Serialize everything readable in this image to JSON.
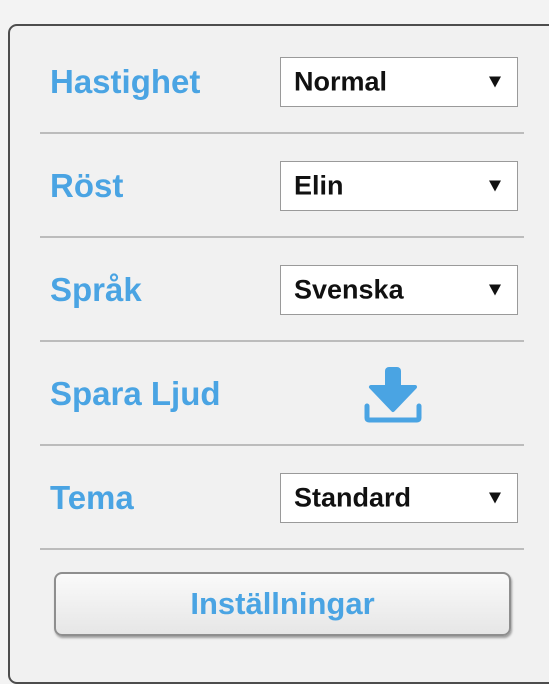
{
  "settings": {
    "rows": [
      {
        "label": "Hastighet",
        "value": "Normal"
      },
      {
        "label": "Röst",
        "value": "Elin"
      },
      {
        "label": "Språk",
        "value": "Svenska"
      },
      {
        "label": "Spara Ljud",
        "icon": "download-icon"
      },
      {
        "label": "Tema",
        "value": "Standard"
      }
    ],
    "button_label": "Inställningar"
  },
  "colors": {
    "accent": "#4aa4e3",
    "text": "#111111",
    "panel_bg": "#f1f1f1"
  }
}
